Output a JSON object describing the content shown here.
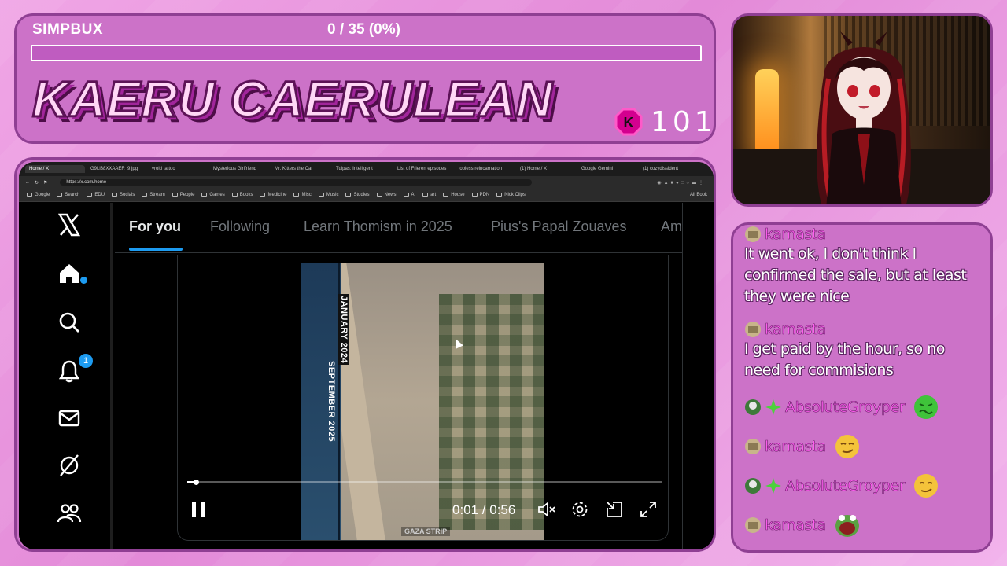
{
  "overlay": {
    "simpbux_label": "SIMPBUX",
    "simpbux_count": "0 / 35 (0%)",
    "simpbux_progress": 0,
    "streamer_name": "KAERU CAERULEAN",
    "badge_count": "101",
    "colors": {
      "panel": "#cc72c8",
      "border": "#8f3f93",
      "name_text": "#ffd7f6"
    }
  },
  "browser": {
    "tabs": [
      "Home / X",
      "G9Ll38XXAAER_9.jpg",
      "vroid tattoo",
      "Mysterious Girlfriend",
      "Mr. Kitters the Cat",
      "Tulpas: Intelligent",
      "List of Frieren episodes",
      "jobless reincarnation",
      "(1) Home / X",
      "Google Gemini",
      "(1) cozydissident"
    ],
    "url": "https://x.com/home",
    "bookmarks": [
      "Google",
      "Search",
      "EDU",
      "Socials",
      "Stream",
      "People",
      "Games",
      "Books",
      "Medicine",
      "Misc",
      "Music",
      "Studies",
      "News",
      "AI",
      "art",
      "House",
      "PDN",
      "Nick Clips"
    ],
    "bookmarks_right": "All Book"
  },
  "x": {
    "nav_icons": [
      "x-logo-icon",
      "home-icon",
      "search-icon",
      "bell-icon",
      "mail-icon",
      "grok-icon",
      "communities-icon"
    ],
    "notification_count": "1",
    "tabs": [
      "For you",
      "Following",
      "Learn Thomism in 2025",
      "Pius's Papal Zouaves",
      "Am"
    ],
    "active_tab": "For you",
    "video": {
      "label_top": "JANUARY 2024",
      "label_bottom": "SEPTEMBER 2025",
      "caption": "GAZA STRIP",
      "time": "0:01 / 0:56",
      "progress": 0.018,
      "controls": [
        "pause-icon",
        "mute-icon",
        "settings-icon",
        "picture-in-picture-icon",
        "fullscreen-icon"
      ]
    }
  },
  "chat": {
    "messages": [
      {
        "user": "kamasta",
        "text": "It went ok, I don't think I confirmed the sale, but at least they were nice"
      },
      {
        "user": "kamasta",
        "text": "I get paid by the hour, so no need for commisions"
      },
      {
        "user": "AbsoluteGroyper",
        "emote": "nauseated-emote"
      },
      {
        "user": "kamasta",
        "emote": "smirk-emote"
      },
      {
        "user": "AbsoluteGroyper",
        "emote": "smirk-emote"
      },
      {
        "user": "kamasta",
        "emote": "frog-mouth-emote"
      }
    ]
  }
}
